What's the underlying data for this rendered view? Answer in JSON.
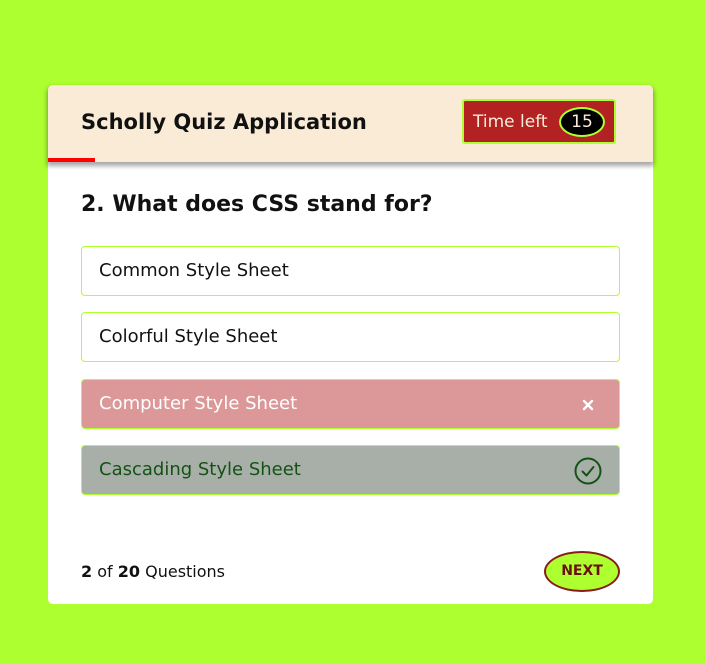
{
  "header": {
    "title": "Scholly Quiz Application",
    "timer_label": "Time left",
    "timer_seconds": "15"
  },
  "question": {
    "text": "2. What does CSS stand for?",
    "options": [
      {
        "label": "Common Style Sheet",
        "state": "default"
      },
      {
        "label": "Colorful Style Sheet",
        "state": "default"
      },
      {
        "label": "Computer Style Sheet",
        "state": "incorrect",
        "icon": "cross-icon"
      },
      {
        "label": "Cascading Style Sheet",
        "state": "correct",
        "icon": "check-circle-icon"
      }
    ]
  },
  "footer": {
    "current": "2",
    "of_text": "of",
    "total": "20",
    "questions_text": "Questions",
    "next_label": "NEXT"
  },
  "colors": {
    "page_background": "#adff2f",
    "header_background": "#faebd7",
    "timer_background": "#b22222",
    "incorrect_background": "#dc9898",
    "correct_background": "#a7afa8",
    "correct_text": "#145214",
    "time_line": "#ff0000"
  }
}
